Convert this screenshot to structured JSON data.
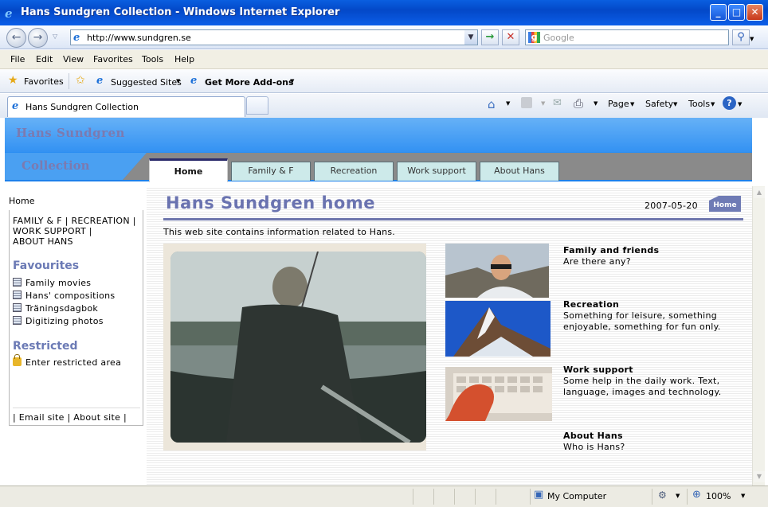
{
  "window": {
    "title": "Hans Sundgren Collection - Windows Internet Explorer"
  },
  "address": {
    "url": "http://www.sundgren.se",
    "search_placeholder": "Google"
  },
  "menu": [
    "File",
    "Edit",
    "View",
    "Favorites",
    "Tools",
    "Help"
  ],
  "favorites_bar": {
    "favorites": "Favorites",
    "suggested": "Suggested Sites",
    "addons": "Get More Add-ons"
  },
  "tab": {
    "title": "Hans Sundgren Collection"
  },
  "command_bar": {
    "page": "Page",
    "safety": "Safety",
    "tools": "Tools"
  },
  "site": {
    "header_line1": "Hans Sundgren",
    "header_line2": "Collection",
    "tabs": [
      "Home",
      "Family & F",
      "Recreation",
      "Work support",
      "About Hans"
    ],
    "active_tab": "Home"
  },
  "sidebar": {
    "home": "Home",
    "sections_line1": "FAMILY & F | RECREATION |",
    "sections_line2": "WORK SUPPORT |",
    "sections_line3": "ABOUT HANS",
    "favourites_heading": "Favourites",
    "favourites": [
      "Family movies",
      "Hans' compositions",
      "Träningsdagbok",
      "Digitizing photos"
    ],
    "restricted_heading": "Restricted",
    "restricted_link": "Enter restricted area",
    "bottom_links": "| Email site | About site |"
  },
  "main": {
    "title": "Hans Sundgren home",
    "date": "2007-05-20",
    "home_badge": "Home",
    "intro": "This web site contains information related to Hans.",
    "features": [
      {
        "title": "Family and friends",
        "desc1": "Are there any?",
        "desc2": ""
      },
      {
        "title": "Recreation",
        "desc1": "Something for leisure, something",
        "desc2": "enjoyable, something for fun only."
      },
      {
        "title": "Work support",
        "desc1": "Some help in the daily work. Text,",
        "desc2": "language, images and technology."
      },
      {
        "title": "About Hans",
        "desc1": "Who is Hans?",
        "desc2": ""
      }
    ]
  },
  "status": {
    "zone": "My Computer",
    "zoom": "100%"
  },
  "colors": {
    "title_bar": "#0348c8",
    "site_blue": "#2d8ef2",
    "heading": "#6a73b0",
    "tab_bg": "#cdeaea"
  }
}
